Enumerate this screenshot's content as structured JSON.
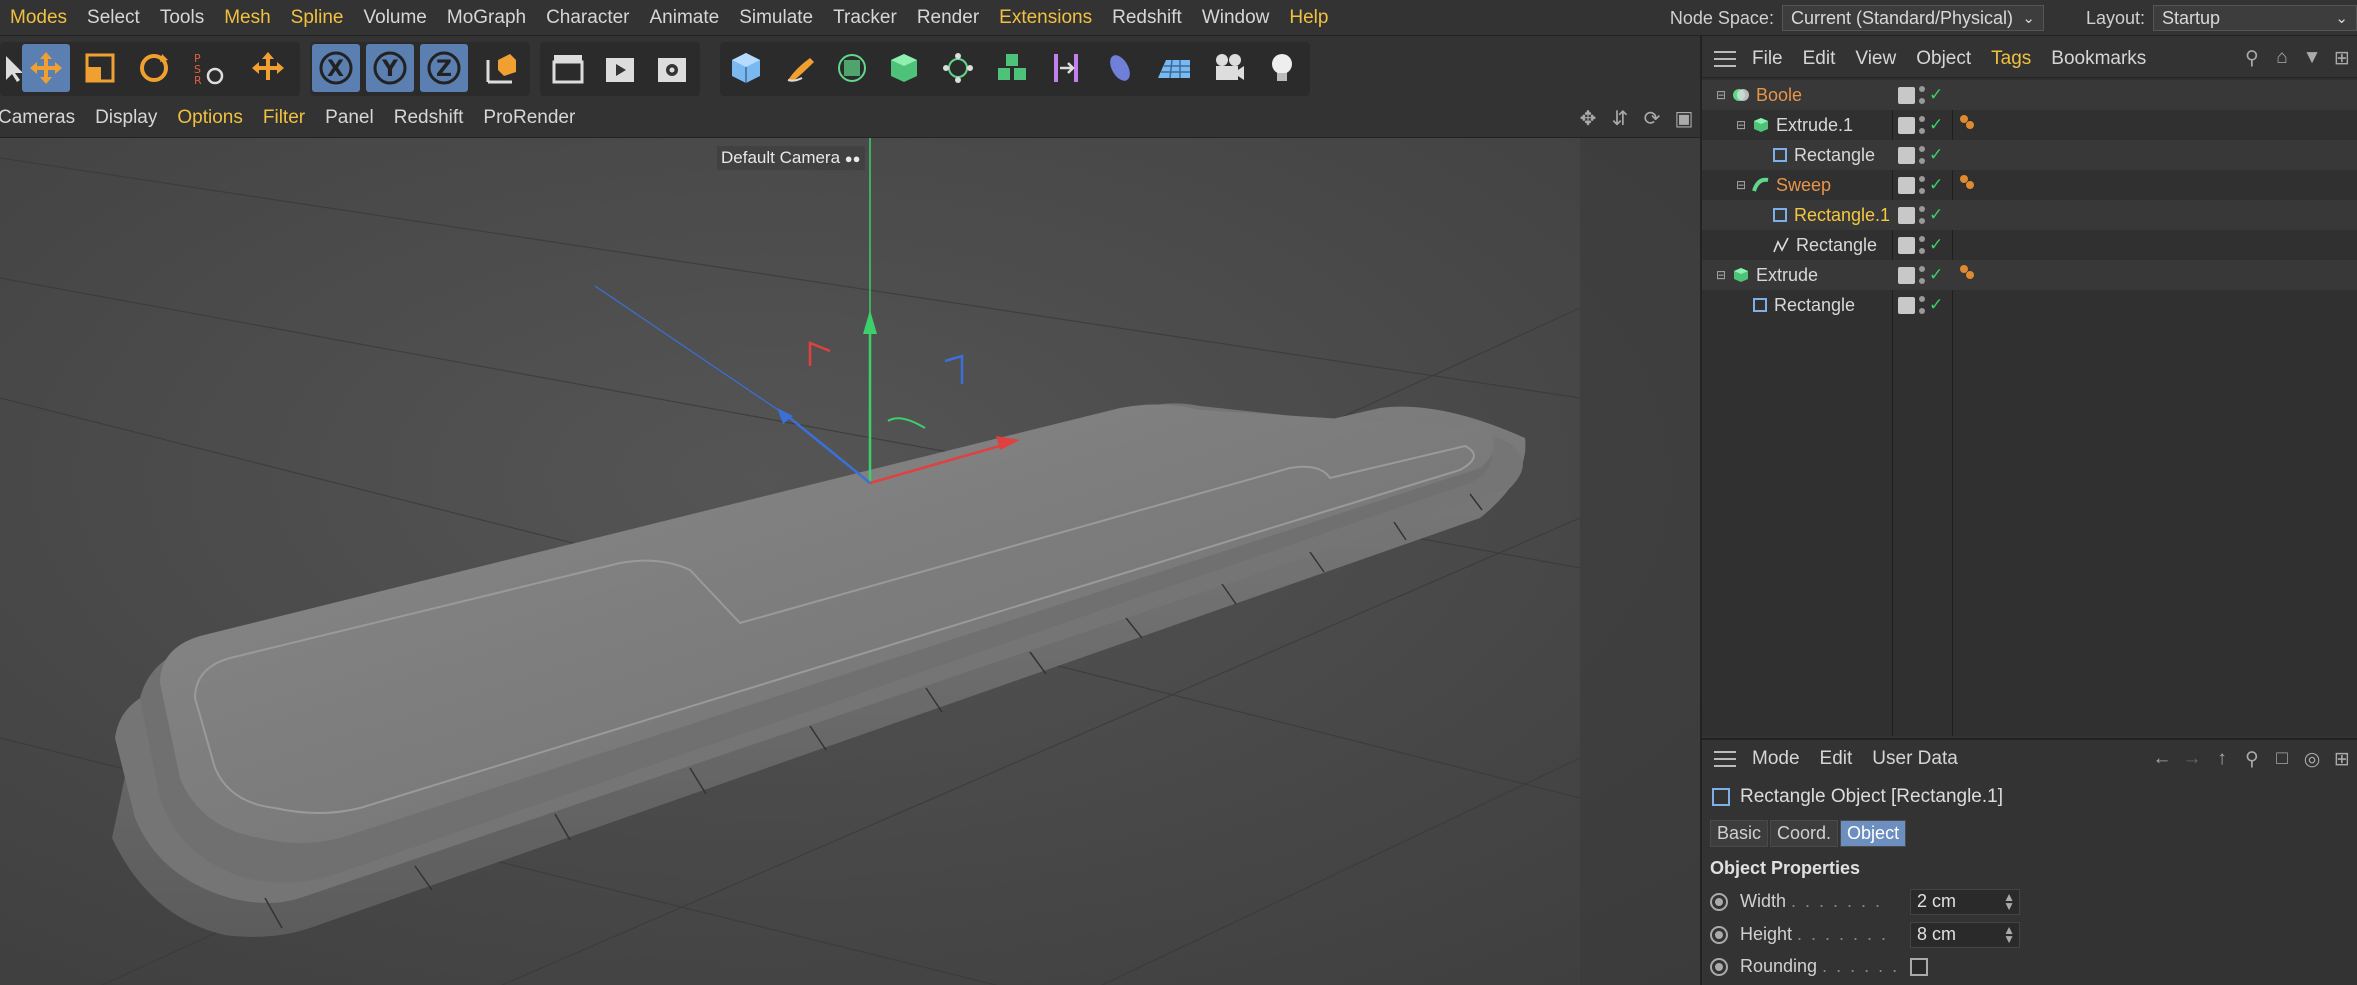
{
  "menubar": {
    "items": [
      "Modes",
      "Select",
      "Tools",
      "Mesh",
      "Spline",
      "Volume",
      "MoGraph",
      "Character",
      "Animate",
      "Simulate",
      "Tracker",
      "Render",
      "Extensions",
      "Redshift",
      "Window",
      "Help"
    ],
    "highlighted": [
      "Modes",
      "Mesh",
      "Spline",
      "Extensions",
      "Help"
    ],
    "node_space_label": "Node Space:",
    "node_space_value": "Current (Standard/Physical)",
    "layout_label": "Layout:",
    "layout_value": "Startup"
  },
  "viewport_menu": {
    "items": [
      "Cameras",
      "Display",
      "Options",
      "Filter",
      "Panel",
      "Redshift",
      "ProRender"
    ],
    "highlighted": [
      "Options",
      "Filter"
    ],
    "camera_label": "Default Camera"
  },
  "object_manager": {
    "menu": [
      "File",
      "Edit",
      "View",
      "Object",
      "Tags",
      "Bookmarks"
    ],
    "highlighted": [
      "Tags"
    ],
    "objects": [
      {
        "name": "Boole",
        "depth": 0,
        "icon": "boole-icon",
        "color": "orange",
        "tag": false
      },
      {
        "name": "Extrude.1",
        "depth": 1,
        "icon": "extrude-icon",
        "color": "normal",
        "tag": true
      },
      {
        "name": "Rectangle",
        "depth": 2,
        "icon": "rectangle-icon",
        "color": "normal",
        "tag": false
      },
      {
        "name": "Sweep",
        "depth": 1,
        "icon": "sweep-icon",
        "color": "orange",
        "tag": true
      },
      {
        "name": "Rectangle.1",
        "depth": 2,
        "icon": "rectangle-icon",
        "color": "yellow",
        "tag": false
      },
      {
        "name": "Rectangle",
        "depth": 2,
        "icon": "spline-icon",
        "color": "normal",
        "tag": false
      },
      {
        "name": "Extrude",
        "depth": 0,
        "icon": "extrude-icon",
        "color": "normal",
        "tag": true
      },
      {
        "name": "Rectangle",
        "depth": 1,
        "icon": "rectangle-icon",
        "color": "normal",
        "tag": false
      }
    ]
  },
  "attribute_manager": {
    "menu": [
      "Mode",
      "Edit",
      "User Data"
    ],
    "title": "Rectangle Object [Rectangle.1]",
    "tabs": [
      "Basic",
      "Coord.",
      "Object"
    ],
    "active_tab": "Object",
    "section": "Object Properties",
    "props": [
      {
        "label": "Width",
        "value": "2 cm"
      },
      {
        "label": "Height",
        "value": "8 cm"
      },
      {
        "label": "Rounding",
        "value": ""
      }
    ]
  },
  "colors": {
    "accent_orange": "#e8944a",
    "highlight_yellow": "#f0c040",
    "selected_blue": "#5a7fb0",
    "check_green": "#3ccf6a"
  }
}
